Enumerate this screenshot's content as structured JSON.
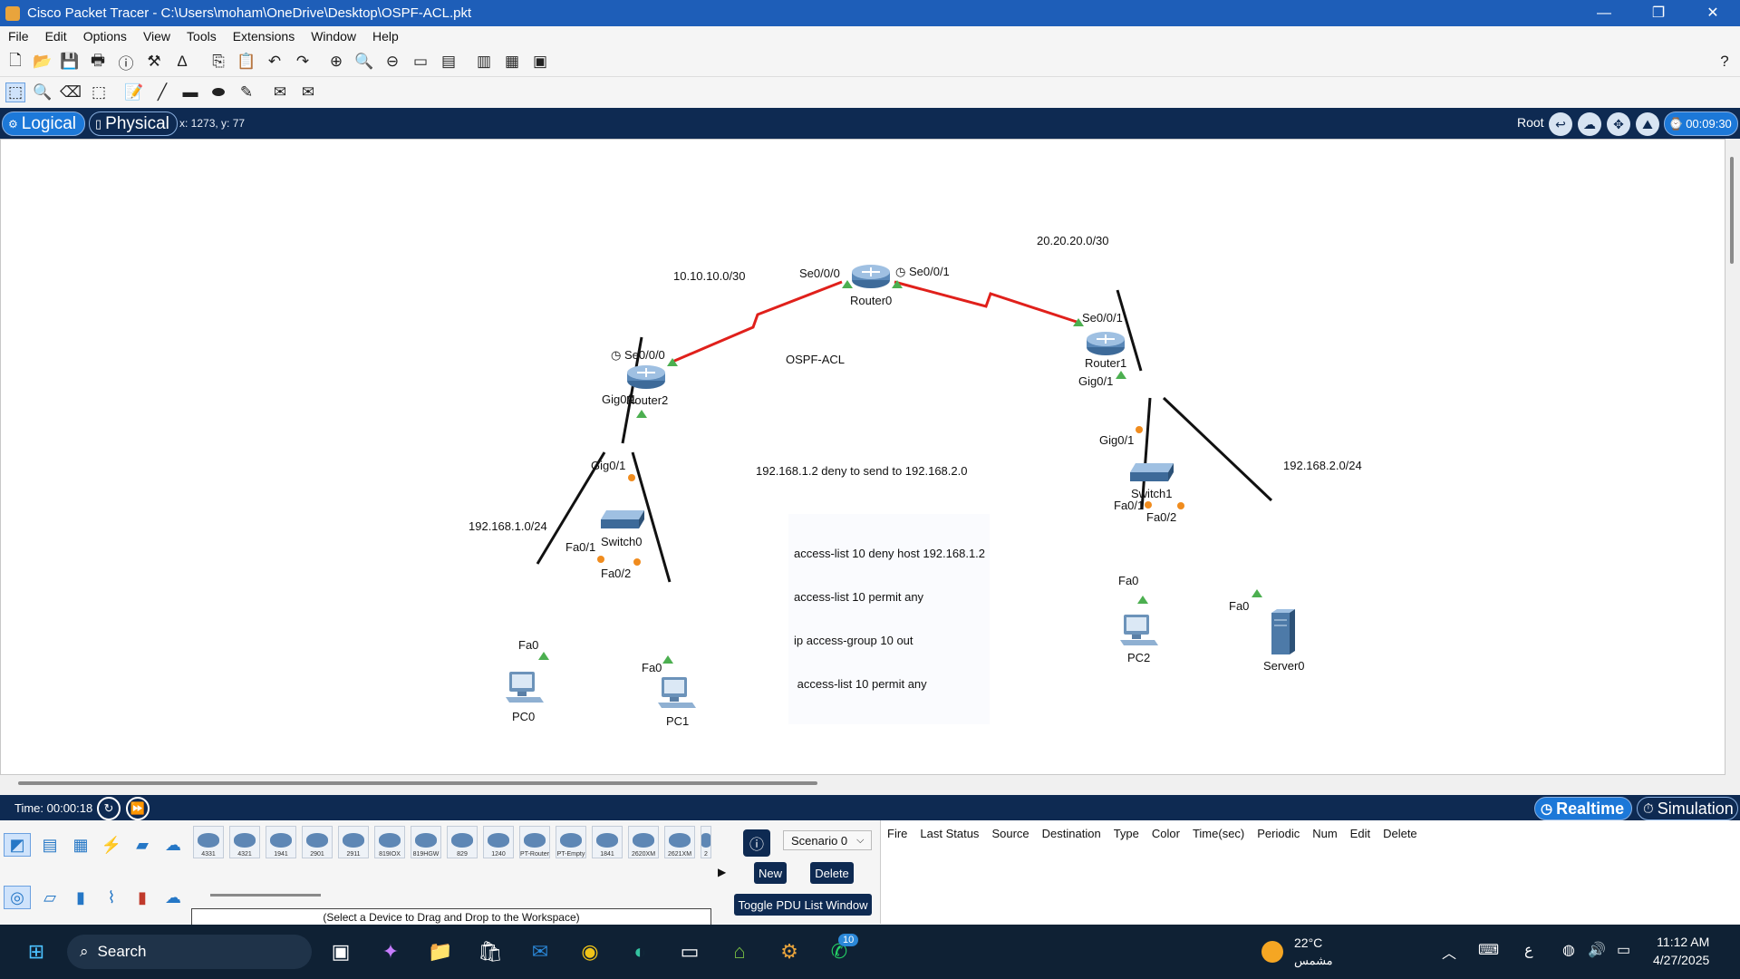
{
  "window": {
    "title": "Cisco Packet Tracer - C:\\Users\\moham\\OneDrive\\Desktop\\OSPF-ACL.pkt",
    "minimize": "—",
    "maximize": "❐",
    "close": "✕"
  },
  "menu": [
    "File",
    "Edit",
    "Options",
    "View",
    "Tools",
    "Extensions",
    "Window",
    "Help"
  ],
  "toolbar": {
    "help": "?"
  },
  "viewbar": {
    "logical": "Logical",
    "physical": "Physical",
    "coords": "x: 1273, y: 77",
    "root": "Root",
    "clock": "00:09:30"
  },
  "workspace": {
    "devices": {
      "router0": "Router0",
      "router1": "Router1",
      "router2": "Router2",
      "switch0": "Switch0",
      "switch1": "Switch1",
      "pc0": "PC0",
      "pc1": "PC1",
      "pc2": "PC2",
      "server0": "Server0"
    },
    "ports": {
      "r0_se000": "Se0/0/0",
      "r0_se001": "Se0/0/1",
      "r2_se000": "Se0/0/0",
      "r2_gig01": "Gig0/1",
      "r1_se001": "Se0/0/1",
      "r1_gig01": "Gig0/1",
      "sw0_gig01": "Gig0/1",
      "sw0_fa01": "Fa0/1",
      "sw0_fa02": "Fa0/2",
      "sw1_gig01": "Gig0/1",
      "sw1_fa01": "Fa0/1",
      "sw1_fa02": "Fa0/2",
      "pc0_fa0": "Fa0",
      "pc1_fa0": "Fa0",
      "pc2_fa0": "Fa0",
      "server0_fa0": "Fa0"
    },
    "notes": {
      "net_10": "10.10.10.0/30",
      "net_20": "20.20.20.0/30",
      "title": "OSPF-ACL",
      "deny_note": "192.168.1.2 deny to send to 192.168.2.0",
      "lan1": "192.168.1.0/24",
      "lan2": "192.168.2.0/24",
      "acl_lines": [
        "access-list 10 deny host 192.168.1.2",
        "access-list 10 permit any",
        "ip access-group 10 out",
        " access-list 10 permit any"
      ]
    }
  },
  "statusbar": {
    "time": "Time: 00:00:18",
    "realtime": "Realtime",
    "simulation": "Simulation"
  },
  "palette": {
    "devices": [
      "4331",
      "4321",
      "1941",
      "2901",
      "2911",
      "819IOX",
      "819HGW",
      "829",
      "1240",
      "PT-Router",
      "PT-Empty",
      "1841",
      "2620XM",
      "2621XM",
      "2"
    ],
    "help": "(Select a Device to Drag and Drop to the Workspace)"
  },
  "scenario": {
    "selected": "Scenario 0",
    "new": "New",
    "delete": "Delete",
    "toggle": "Toggle PDU List Window"
  },
  "pdu_columns": [
    "Fire",
    "Last Status",
    "Source",
    "Destination",
    "Type",
    "Color",
    "Time(sec)",
    "Periodic",
    "Num",
    "Edit",
    "Delete"
  ],
  "taskbar": {
    "search": "Search",
    "temp": "22°C",
    "condition": "مشمس",
    "lang": "ع",
    "time": "11:12 AM",
    "date": "4/27/2025",
    "badge": "10"
  },
  "colors": {
    "serial_link": "#e0201b",
    "ethernet_link": "#111111",
    "accent": "#1c78d8",
    "navy": "#0e2a52"
  }
}
